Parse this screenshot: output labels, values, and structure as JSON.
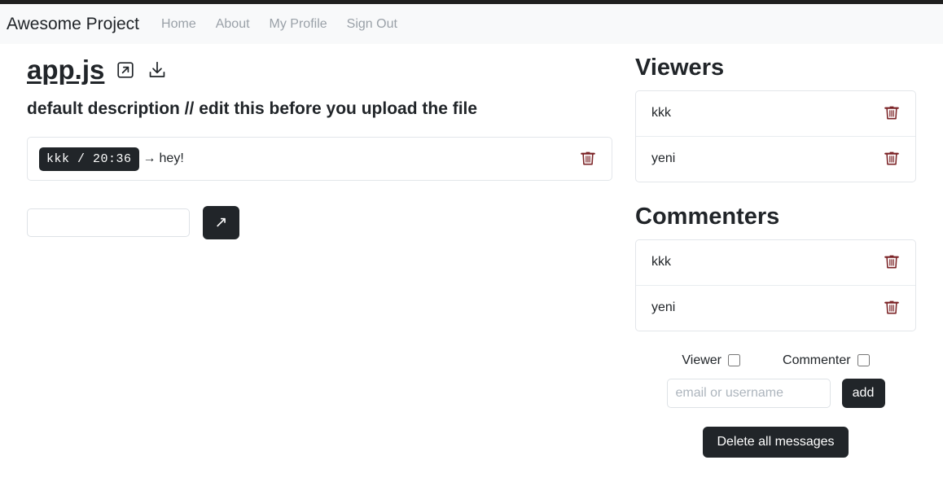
{
  "navbar": {
    "brand": "Awesome Project",
    "links": [
      {
        "label": "Home",
        "name": "nav-link-home"
      },
      {
        "label": "About",
        "name": "nav-link-about"
      },
      {
        "label": "My Profile",
        "name": "nav-link-my-profile"
      },
      {
        "label": "Sign Out",
        "name": "nav-link-sign-out"
      }
    ]
  },
  "file": {
    "title": "app.js",
    "open_icon": "external-link-icon",
    "download_icon": "download-icon",
    "description": "default description // edit this before you upload the file"
  },
  "messages": [
    {
      "author": "kkk",
      "time": "20:36",
      "badge": "kkk / 20:36",
      "separator": "→",
      "text": "hey!",
      "delete_icon": "trash-icon"
    }
  ],
  "compose": {
    "value": "",
    "placeholder": "",
    "send_label": "↗"
  },
  "viewers": {
    "title": "Viewers",
    "items": [
      {
        "label": "kkk"
      },
      {
        "label": "yeni"
      }
    ]
  },
  "commenters": {
    "title": "Commenters",
    "items": [
      {
        "label": "kkk"
      },
      {
        "label": "yeni"
      }
    ]
  },
  "add_form": {
    "viewer_label": "Viewer",
    "viewer_checked": false,
    "commenter_label": "Commenter",
    "commenter_checked": false,
    "input_value": "",
    "input_placeholder": "email or username",
    "add_label": "add"
  },
  "actions": {
    "delete_all_label": "Delete all messages"
  },
  "colors": {
    "navbar_bg": "#f8f9fa",
    "dark": "#212529",
    "trash": "#7b2326",
    "border": "#e3e6ea",
    "muted": "#9aa1a8"
  }
}
